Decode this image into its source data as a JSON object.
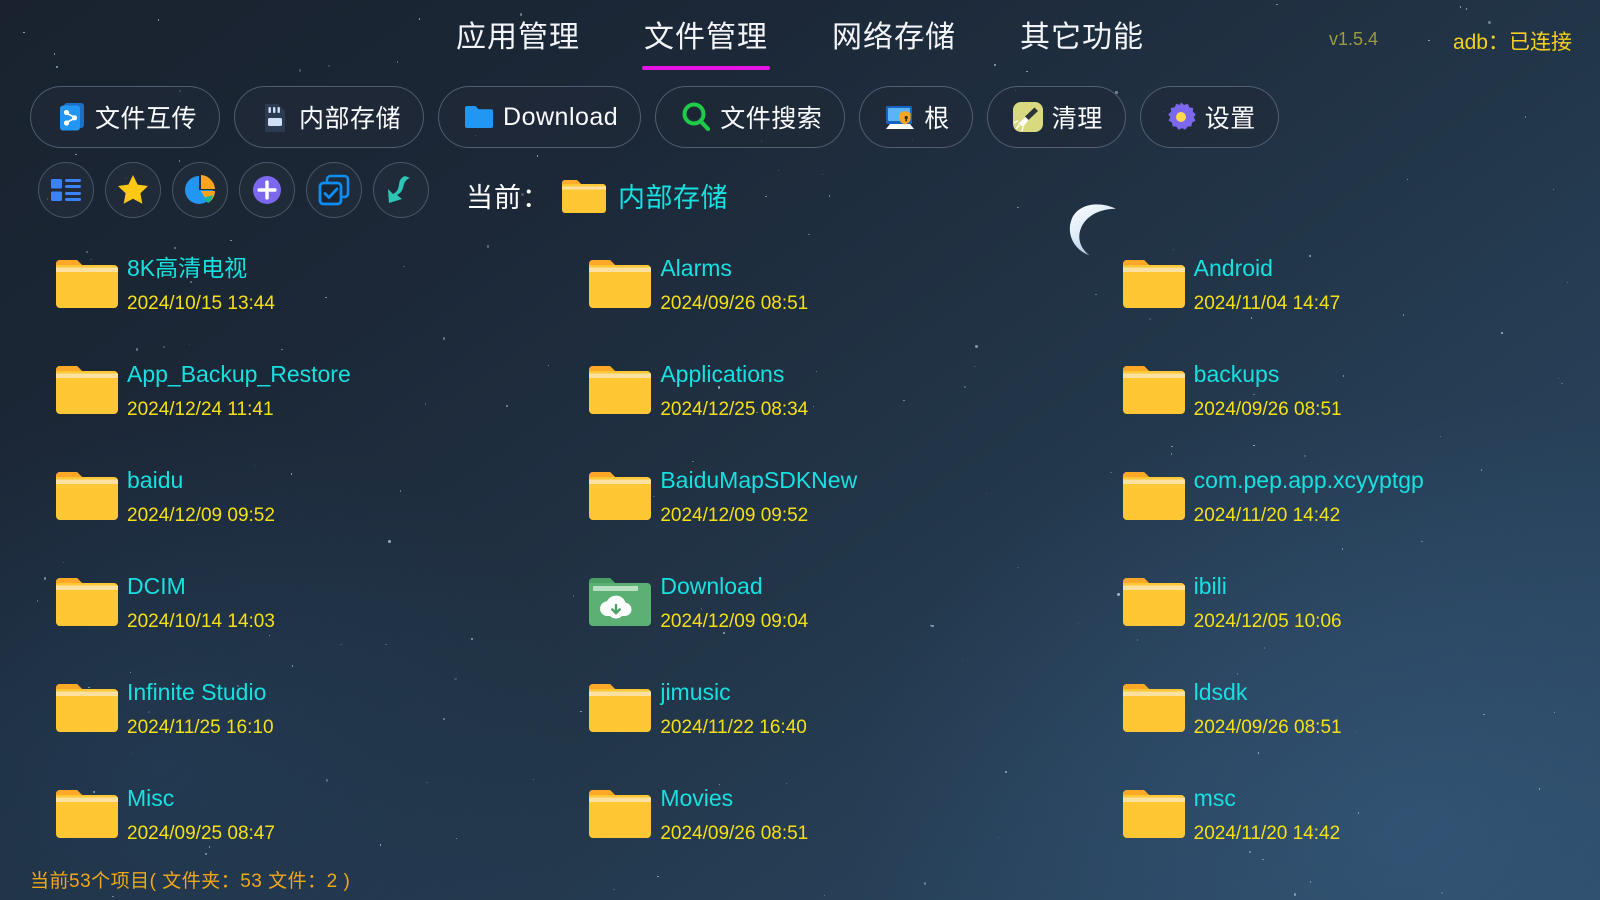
{
  "header": {
    "tabs": [
      {
        "label": "应用管理",
        "active": false
      },
      {
        "label": "文件管理",
        "active": true
      },
      {
        "label": "网络存储",
        "active": false
      },
      {
        "label": "其它功能",
        "active": false
      }
    ],
    "version": "v1.5.4",
    "adb_status": "adb：已连接",
    "active_tab_underline_color": "#e516e5"
  },
  "toolbar": {
    "buttons": [
      {
        "label": "文件互传",
        "icon": "share-files-icon"
      },
      {
        "label": "内部存储",
        "icon": "sd-card-icon"
      },
      {
        "label": "Download",
        "icon": "folder-blue-icon"
      },
      {
        "label": "文件搜索",
        "icon": "search-green-icon"
      },
      {
        "label": "根",
        "icon": "root-monitor-shield-icon"
      },
      {
        "label": "清理",
        "icon": "broom-clean-icon"
      },
      {
        "label": "设置",
        "icon": "gear-purple-icon"
      }
    ]
  },
  "actionbar": {
    "buttons": [
      {
        "icon": "list-view-icon"
      },
      {
        "icon": "star-favorite-icon"
      },
      {
        "icon": "pie-chart-storage-icon"
      },
      {
        "icon": "plus-add-icon"
      },
      {
        "icon": "multi-select-icon"
      },
      {
        "icon": "refresh-sync-icon"
      }
    ]
  },
  "path": {
    "label": "当前：",
    "folder_icon": "folder-yellow-icon",
    "current": "内部存储"
  },
  "files": [
    {
      "name": "8K高清电视",
      "date": "2024/10/15 13:44",
      "icon": "folder-yellow-icon"
    },
    {
      "name": "Alarms",
      "date": "2024/09/26 08:51",
      "icon": "folder-yellow-icon"
    },
    {
      "name": "Android",
      "date": "2024/11/04 14:47",
      "icon": "folder-yellow-icon"
    },
    {
      "name": "App_Backup_Restore",
      "date": "2024/12/24 11:41",
      "icon": "folder-yellow-icon"
    },
    {
      "name": "Applications",
      "date": "2024/12/25 08:34",
      "icon": "folder-yellow-icon"
    },
    {
      "name": "backups",
      "date": "2024/09/26 08:51",
      "icon": "folder-yellow-icon"
    },
    {
      "name": "baidu",
      "date": "2024/12/09 09:52",
      "icon": "folder-yellow-icon"
    },
    {
      "name": "BaiduMapSDKNew",
      "date": "2024/12/09 09:52",
      "icon": "folder-yellow-icon"
    },
    {
      "name": "com.pep.app.xcyyptgp",
      "date": "2024/11/20 14:42",
      "icon": "folder-yellow-icon"
    },
    {
      "name": "DCIM",
      "date": "2024/10/14 14:03",
      "icon": "folder-yellow-icon"
    },
    {
      "name": "Download",
      "date": "2024/12/09 09:04",
      "icon": "folder-download-green-icon"
    },
    {
      "name": "ibili",
      "date": "2024/12/05 10:06",
      "icon": "folder-yellow-icon"
    },
    {
      "name": "Infinite Studio",
      "date": "2024/11/25 16:10",
      "icon": "folder-yellow-icon"
    },
    {
      "name": "jimusic",
      "date": "2024/11/22 16:40",
      "icon": "folder-yellow-icon"
    },
    {
      "name": "ldsdk",
      "date": "2024/09/26 08:51",
      "icon": "folder-yellow-icon"
    },
    {
      "name": "Misc",
      "date": "2024/09/25 08:47",
      "icon": "folder-yellow-icon"
    },
    {
      "name": "Movies",
      "date": "2024/09/26 08:51",
      "icon": "folder-yellow-icon"
    },
    {
      "name": "msc",
      "date": "2024/11/20 14:42",
      "icon": "folder-yellow-icon"
    }
  ],
  "status": {
    "text": "当前53个项目( 文件夹：53  文件：2 )"
  },
  "colors": {
    "accent_magenta": "#e516e5",
    "file_name_cyan": "#16e0e0",
    "file_date_yellow": "#f5e014",
    "status_orange": "#f0a818",
    "adb_yellow": "#f5d020",
    "folder_yellow": "#ffc734"
  }
}
